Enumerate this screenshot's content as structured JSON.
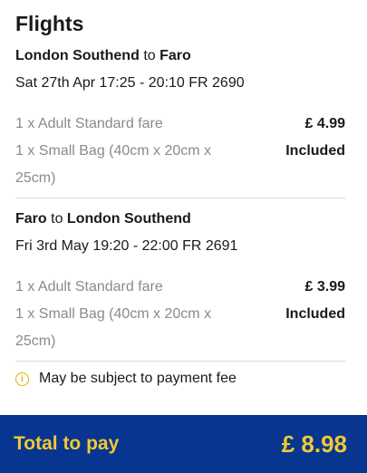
{
  "header": {
    "title": "Flights"
  },
  "flights": [
    {
      "from": "London Southend",
      "connector": "to",
      "to": "Faro",
      "schedule": "Sat 27th Apr 17:25 - 20:10 FR 2690",
      "lines": [
        {
          "label": "1 x Adult Standard fare",
          "value": "£ 4.99"
        },
        {
          "label": "1 x Small Bag (40cm x 20cm x 25cm)",
          "value": "Included"
        }
      ]
    },
    {
      "from": "Faro",
      "connector": "to",
      "to": "London Southend",
      "schedule": "Fri 3rd May 19:20 - 22:00 FR 2691",
      "lines": [
        {
          "label": "1 x Adult Standard fare",
          "value": "£ 3.99"
        },
        {
          "label": "1 x Small Bag (40cm x 20cm x 25cm)",
          "value": "Included"
        }
      ]
    }
  ],
  "note": {
    "icon": "info-icon",
    "text": "May be subject to payment fee"
  },
  "total": {
    "label": "Total to pay",
    "value": "£ 8.98"
  },
  "colors": {
    "brand_blue": "#073590",
    "accent_yellow": "#f1c933",
    "muted_text": "#8a8a8a"
  }
}
